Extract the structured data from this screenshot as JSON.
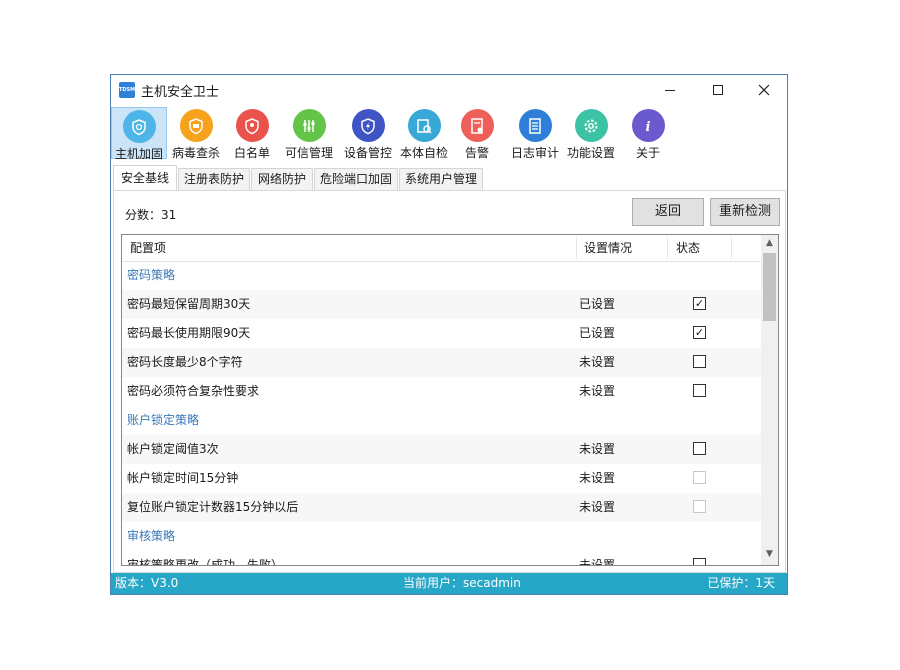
{
  "window": {
    "title": "主机安全卫士",
    "logo_text": "TDSM"
  },
  "toolbar": [
    {
      "label": "主机加固",
      "icon": "shield-search-icon",
      "color": "#4db5e8",
      "active": true
    },
    {
      "label": "病毒查杀",
      "icon": "virus-shield-icon",
      "color": "#f6a21c"
    },
    {
      "label": "白名单",
      "icon": "whitelist-shield-icon",
      "color": "#e9534b"
    },
    {
      "label": "可信管理",
      "icon": "sliders-icon",
      "color": "#64c349"
    },
    {
      "label": "设备管控",
      "icon": "lightning-shield-icon",
      "color": "#3f55c5"
    },
    {
      "label": "本体自检",
      "icon": "self-check-icon",
      "color": "#38a8d6"
    },
    {
      "label": "告警",
      "icon": "alert-doc-icon",
      "color": "#ee5f5a"
    },
    {
      "label": "日志审计",
      "icon": "log-icon",
      "color": "#2f7ed8"
    },
    {
      "label": "功能设置",
      "icon": "gear-icon",
      "color": "#3cc3a5"
    },
    {
      "label": "关于",
      "icon": "info-icon",
      "color": "#6a5acd"
    }
  ],
  "tabs": [
    "安全基线",
    "注册表防护",
    "网络防护",
    "危险端口加固",
    "系统用户管理"
  ],
  "score": "分数：31",
  "buttons": {
    "back": "返回",
    "recheck": "重新检测"
  },
  "table": {
    "headers": [
      "配置项",
      "设置情况",
      "状态"
    ],
    "rows": [
      {
        "type": "group",
        "name": "密码策略"
      },
      {
        "type": "item",
        "name": "密码最短保留周期30天",
        "setting": "已设置",
        "checked": true,
        "enabled": true
      },
      {
        "type": "item",
        "name": "密码最长使用期限90天",
        "setting": "已设置",
        "checked": true,
        "enabled": true
      },
      {
        "type": "item",
        "name": "密码长度最少8个字符",
        "setting": "未设置",
        "checked": false,
        "enabled": true
      },
      {
        "type": "item",
        "name": "密码必须符合复杂性要求",
        "setting": "未设置",
        "checked": false,
        "enabled": true
      },
      {
        "type": "group",
        "name": "账户锁定策略"
      },
      {
        "type": "item",
        "name": "帐户锁定阈值3次",
        "setting": "未设置",
        "checked": false,
        "enabled": true
      },
      {
        "type": "item",
        "name": "帐户锁定时间15分钟",
        "setting": "未设置",
        "checked": false,
        "enabled": false
      },
      {
        "type": "item",
        "name": "复位账户锁定计数器15分钟以后",
        "setting": "未设置",
        "checked": false,
        "enabled": false
      },
      {
        "type": "group",
        "name": "审核策略"
      },
      {
        "type": "item",
        "name": "审核策略更改（成功、失败）",
        "setting": "未设置",
        "checked": false,
        "enabled": true
      }
    ]
  },
  "status_bar": {
    "version": "版本：V3.0",
    "user": "当前用户：secadmin",
    "protected": "已保护：1天"
  }
}
